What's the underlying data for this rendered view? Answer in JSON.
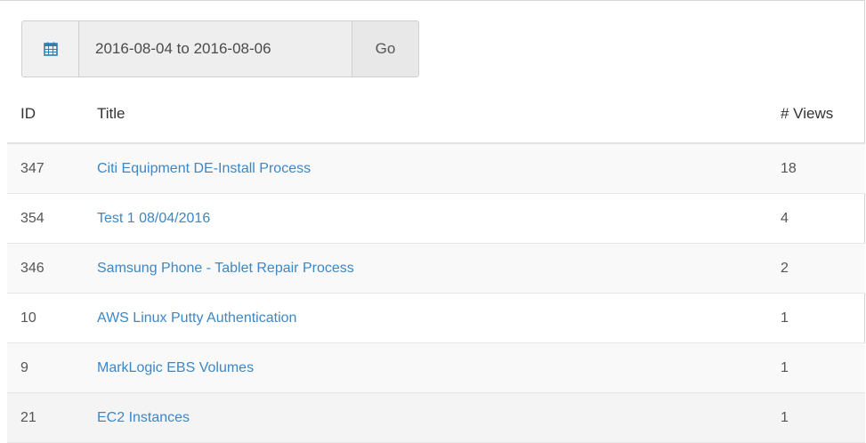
{
  "date_filter": {
    "icon": "calendar-icon",
    "range_value": "2016-08-04 to 2016-08-06",
    "go_label": "Go"
  },
  "table": {
    "headers": {
      "id": "ID",
      "title": "Title",
      "views": "# Views"
    },
    "rows": [
      {
        "id": "347",
        "title": "Citi Equipment DE-Install Process",
        "views": "18"
      },
      {
        "id": "354",
        "title": "Test 1 08/04/2016",
        "views": "4"
      },
      {
        "id": "346",
        "title": "Samsung Phone - Tablet Repair Process",
        "views": "2"
      },
      {
        "id": "10",
        "title": "AWS Linux Putty Authentication",
        "views": "1"
      },
      {
        "id": "9",
        "title": "MarkLogic EBS Volumes",
        "views": "1"
      },
      {
        "id": "21",
        "title": "EC2 Instances",
        "views": "1"
      }
    ]
  },
  "colors": {
    "link": "#3d87c6",
    "row_stripe": "#f9f9f9",
    "border": "#e6e6e6"
  }
}
